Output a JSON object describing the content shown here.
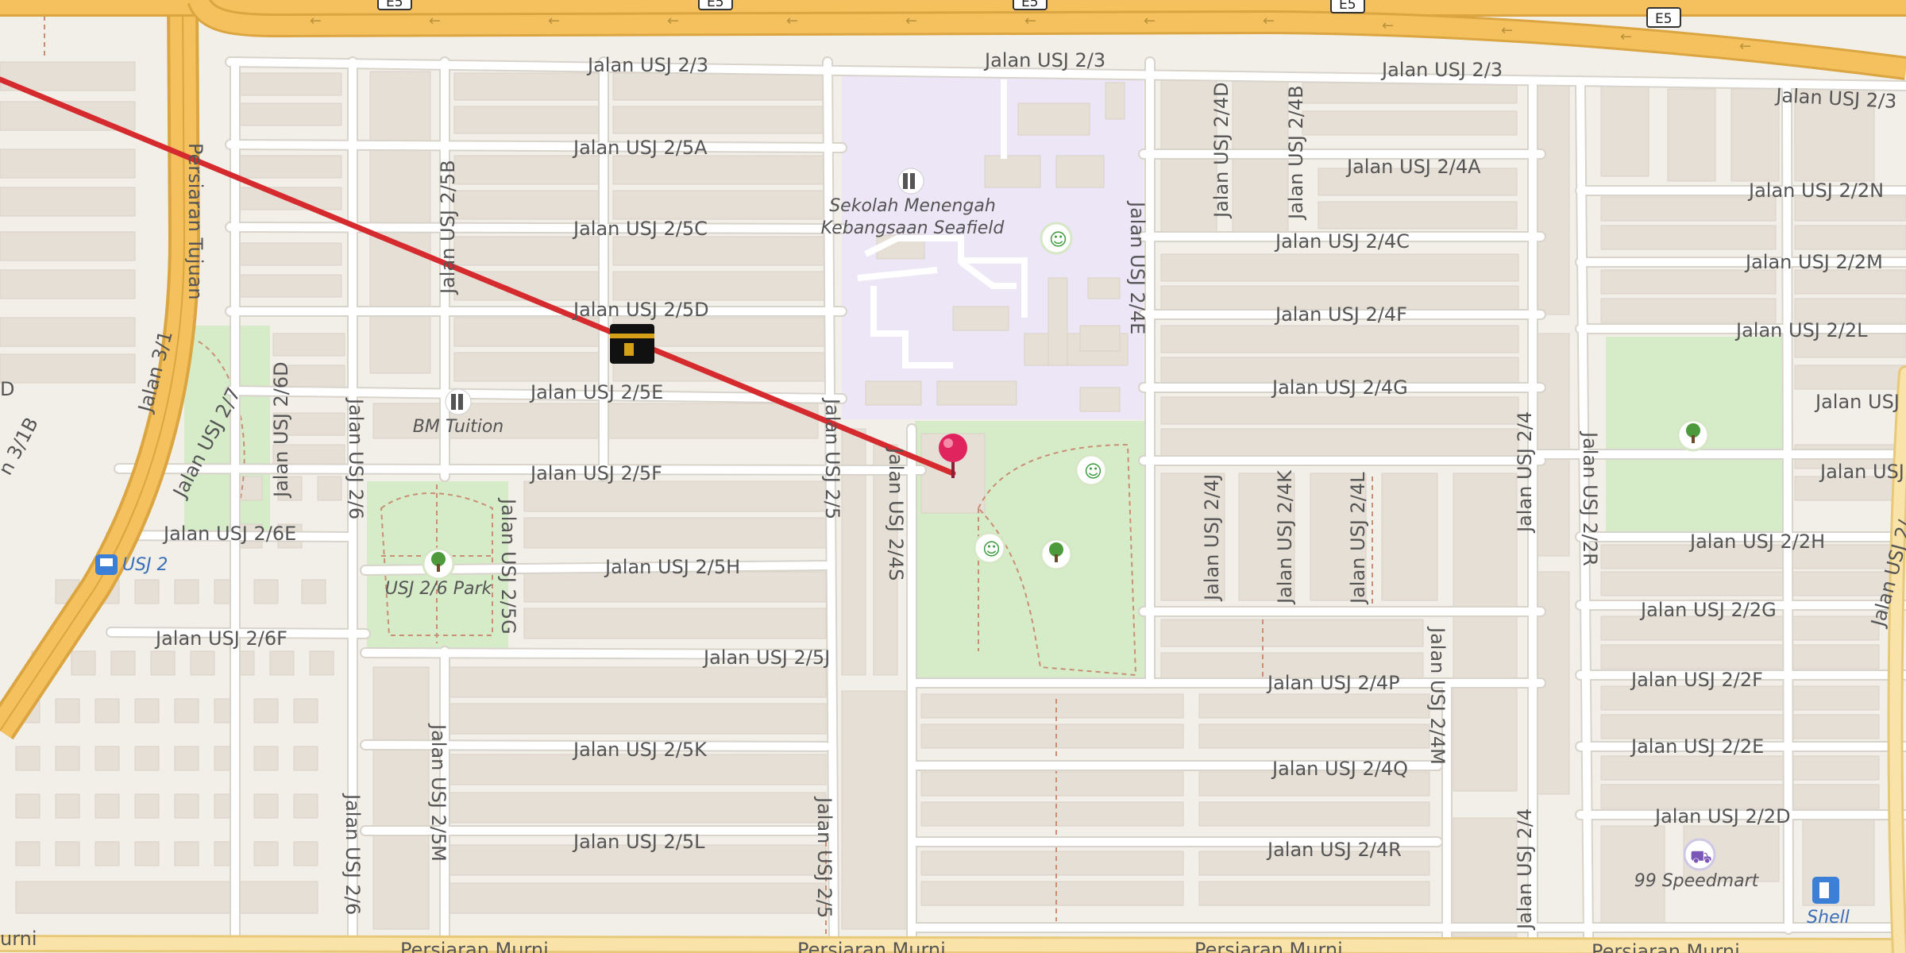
{
  "map": {
    "highway_shields": [
      "E5",
      "E5",
      "E5",
      "E5",
      "E5"
    ],
    "streets": {
      "usj_2_3": "Jalan USJ 2/3",
      "usj_2_5a": "Jalan USJ 2/5A",
      "usj_2_5b": "Jalan USJ 2/5B",
      "usj_2_5c": "Jalan USJ 2/5C",
      "usj_2_5d": "Jalan USJ 2/5D",
      "usj_2_5e": "Jalan USJ 2/5E",
      "usj_2_5f": "Jalan USJ 2/5F",
      "usj_2_5g": "Jalan USJ 2/5G",
      "usj_2_5h": "Jalan USJ 2/5H",
      "usj_2_5j": "Jalan USJ 2/5J",
      "usj_2_5k": "Jalan USJ 2/5K",
      "usj_2_5l": "Jalan USJ 2/5L",
      "usj_2_5m": "Jalan USJ 2/5M",
      "usj_2_5": "Jalan USJ 2/5",
      "usj_2_4s": "Jalan USJ 2/4S",
      "usj_2_4e": "Jalan USJ 2/4E",
      "usj_2_4d": "Jalan USJ 2/4D",
      "usj_2_4b": "Jalan USJ 2/4B",
      "usj_2_4a": "Jalan USJ 2/4A",
      "usj_2_4c": "Jalan USJ 2/4C",
      "usj_2_4f": "Jalan USJ 2/4F",
      "usj_2_4g": "Jalan USJ 2/4G",
      "usj_2_4j": "Jalan USJ 2/4J",
      "usj_2_4k": "Jalan USJ 2/4K",
      "usj_2_4l": "Jalan USJ 2/4L",
      "usj_2_4m": "Jalan USJ 2/4M",
      "usj_2_4p": "Jalan USJ 2/4P",
      "usj_2_4q": "Jalan USJ 2/4Q",
      "usj_2_4r": "Jalan USJ 2/4R",
      "usj_2_4": "Jalan USJ 2/4",
      "usj_2_2n": "Jalan USJ 2/2N",
      "usj_2_2m": "Jalan USJ 2/2M",
      "usj_2_2l": "Jalan USJ 2/2L",
      "usj_2_2j": "Jalan USJ 2/",
      "usj_2_2h": "Jalan USJ 2/2H",
      "usj_2_2g": "Jalan USJ 2/2G",
      "usj_2_2f": "Jalan USJ 2/2F",
      "usj_2_2e": "Jalan USJ 2/2E",
      "usj_2_2d": "Jalan USJ 2/2D",
      "usj_2_2r": "Jalan USJ 2/2R",
      "usj_2_6": "Jalan USJ 2/6",
      "usj_2_6d": "Jalan USJ 2/6D",
      "usj_2_6e": "Jalan USJ 2/6E",
      "usj_2_6f": "Jalan USJ 2/6F",
      "usj_2_7": "Jalan USJ 2/7",
      "usj_2_far_right": "Jalan USJ",
      "usj_2_edge": "Jalan USJ 2/",
      "jalan_3_1": "Jalan 3/1",
      "jalan_3_1b": "n 3/1B",
      "jalan_d": "D",
      "persiaran_tujuan": "Persiaran Tujuan",
      "persiaran_murni": "Persiaran Murni",
      "persiaran_murni_left": "urni"
    },
    "pois": {
      "school_name_1": "Sekolah Menengah",
      "school_name_2": "Kebangsaan Seafield",
      "tuition": "BM Tuition",
      "park": "USJ 2/6 Park",
      "bus_stop": "USJ 2",
      "speedmart": "99 Speedmart",
      "fuel": "Shell"
    },
    "icons": [
      "library-icon",
      "sports-centre-icon",
      "tree-icon",
      "bus-stop-icon",
      "shop-icon",
      "fuel-icon",
      "kaaba-icon",
      "location-pin-icon"
    ],
    "colors": {
      "background": "#f2efe9",
      "motorway": "#f4c15e",
      "motorway_casing": "#dba541",
      "road": "#ffffff",
      "road_casing": "#d8d3cb",
      "building": "#e6dfd6",
      "school_area": "#ece6f6",
      "park": "#d6ecc9",
      "path": "#c98f74",
      "route_line": "#d52b2f",
      "pin": "#e0245e",
      "label": "#555555"
    }
  }
}
